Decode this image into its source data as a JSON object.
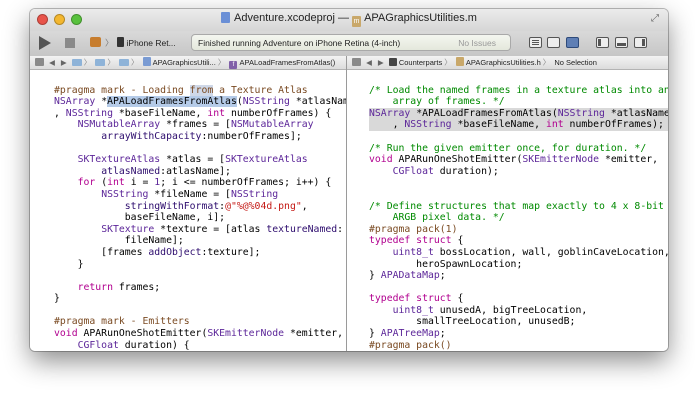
{
  "window": {
    "title_project": "Adventure.xcodeproj",
    "title_sep": "—",
    "title_file": "APAGraphicsUtilities.m",
    "fullscreen_glyph": "⤢"
  },
  "toolbar": {
    "scheme_sep": "〉",
    "scheme_device": "iPhone Ret...",
    "activity_message": "Finished running Adventure on iPhone Retina (4-inch)",
    "activity_issues": "No Issues"
  },
  "jumpbar_left": {
    "file": "APAGraphicsUtili...",
    "func_label": "f",
    "symbol": "APALoadFramesFromAtlas()"
  },
  "jumpbar_right": {
    "counterparts": "Counterparts",
    "file": "APAGraphicsUtilities.h",
    "selection": "No Selection"
  },
  "colors": {
    "comment": "#008a00",
    "keyword": "#b1008f",
    "type": "#5c2699",
    "string": "#c41a16",
    "preprocessor": "#7a4a22"
  },
  "icons": [
    "run-icon",
    "stop-icon",
    "editor-standard-icon",
    "editor-assistant-icon",
    "editor-version-icon",
    "navigator-toggle-icon",
    "debug-toggle-icon",
    "utilities-toggle-icon"
  ]
}
